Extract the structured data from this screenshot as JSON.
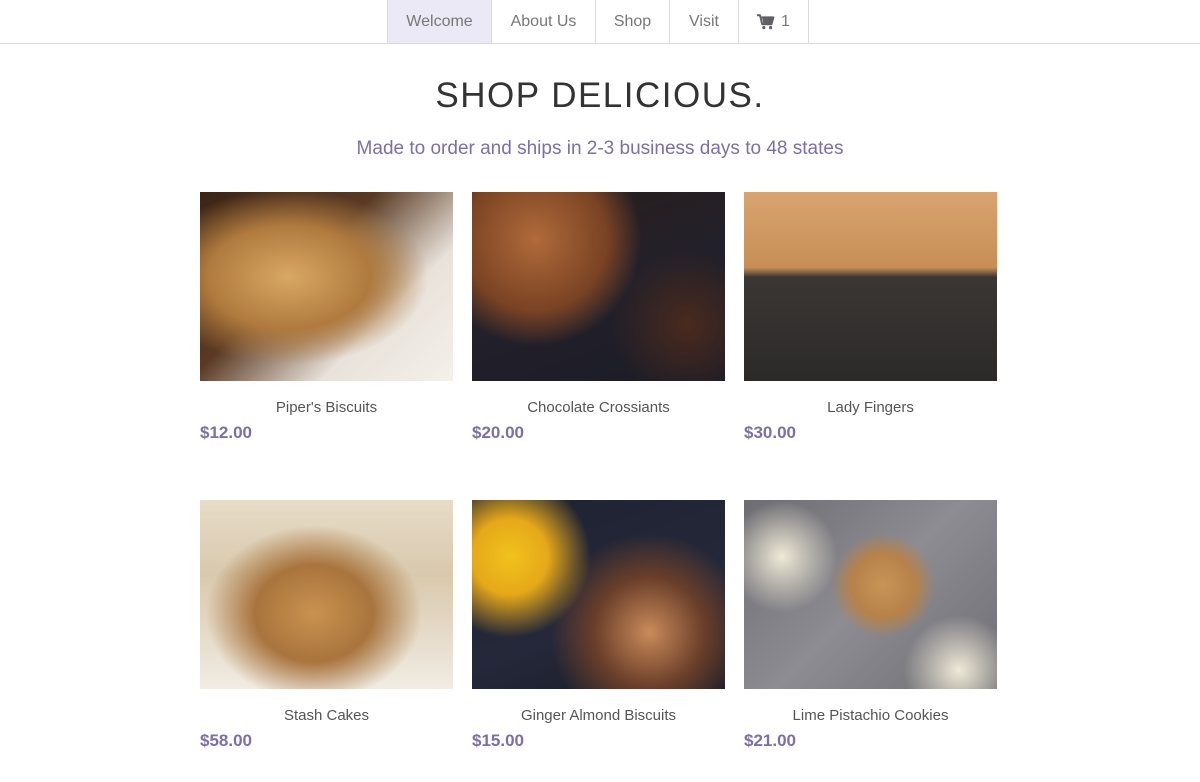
{
  "nav": {
    "items": [
      {
        "label": "Welcome",
        "active": true
      },
      {
        "label": "About Us",
        "active": false
      },
      {
        "label": "Shop",
        "active": false
      },
      {
        "label": "Visit",
        "active": false
      }
    ],
    "cart_count": "1",
    "cart_icon": "shopping-cart-icon"
  },
  "page": {
    "title": "SHOP DELICIOUS.",
    "subtitle": "Made to order and ships in 2-3 business days to 48 states"
  },
  "products": [
    {
      "name": "Piper's Biscuits",
      "price": "$12.00"
    },
    {
      "name": "Chocolate Crossiants",
      "price": "$20.00"
    },
    {
      "name": "Lady Fingers",
      "price": "$30.00"
    },
    {
      "name": "Stash Cakes",
      "price": "$58.00"
    },
    {
      "name": "Ginger Almond Biscuits",
      "price": "$15.00"
    },
    {
      "name": "Lime Pistachio Cookies",
      "price": "$21.00"
    }
  ],
  "colors": {
    "accent": "#7c6fa6",
    "nav_active_bg": "#ebe9f6",
    "border": "#d9d9de"
  }
}
